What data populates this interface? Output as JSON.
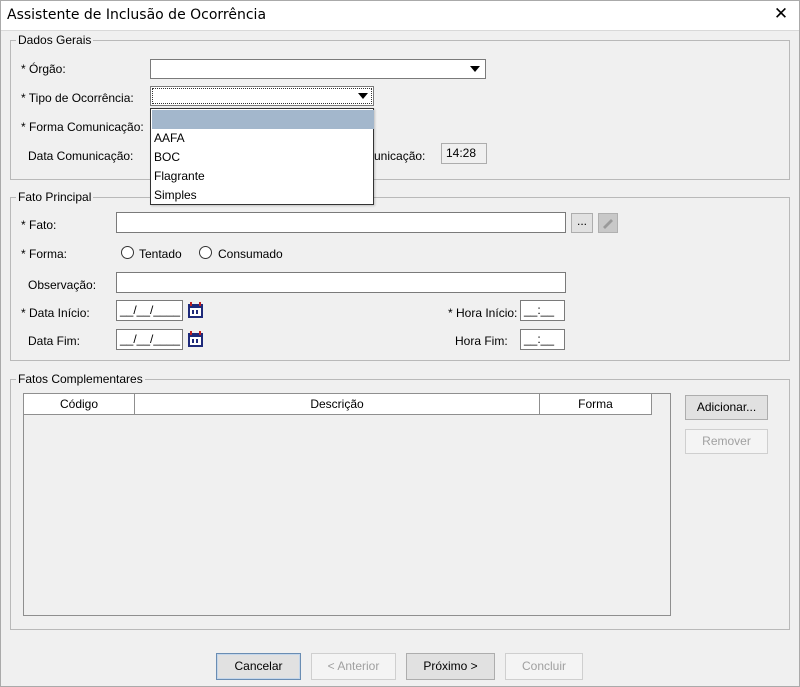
{
  "window": {
    "title": "Assistente de Inclusão de Ocorrência",
    "close_glyph": "✕"
  },
  "dados_gerais": {
    "legend": "Dados Gerais",
    "orgao_label": "* Órgão:",
    "orgao_value": "",
    "tipo_label": "* Tipo de Ocorrência:",
    "tipo_value": "",
    "forma_comunicacao_label": "* Forma Comunicação:",
    "data_comunicacao_label": "Data Comunicação:",
    "hora_comunicacao_partial_label": "unicação:",
    "hora_comunicacao_value": "14:28"
  },
  "tipo_dropdown": {
    "options": [
      "",
      "AAFA",
      "BOC",
      "Flagrante",
      "Simples"
    ],
    "selected_index": 0
  },
  "fato_principal": {
    "legend": "Fato Principal",
    "fato_label": "* Fato:",
    "fato_value": "",
    "browse_button": "...",
    "forma_label": "* Forma:",
    "tentado_label": "Tentado",
    "consumado_label": "Consumado",
    "observacao_label": "Observação:",
    "observacao_value": "",
    "data_inicio_label": "* Data Início:",
    "data_inicio_value": "__/__/____",
    "hora_inicio_label": "* Hora Início:",
    "hora_inicio_value": "__:__",
    "data_fim_label": "Data Fim:",
    "data_fim_value": "__/__/____",
    "hora_fim_label": "Hora Fim:",
    "hora_fim_value": "__:__"
  },
  "fatos_complementares": {
    "legend": "Fatos Complementares",
    "columns": [
      "Código",
      "Descrição",
      "Forma"
    ],
    "adicionar": "Adicionar...",
    "remover": "Remover"
  },
  "footer": {
    "cancelar": "Cancelar",
    "anterior": "< Anterior",
    "proximo": "Próximo >",
    "concluir": "Concluir"
  },
  "colors": {
    "dropdown_selection": "#a3b7cc",
    "calendar_icon": "#1e2a7a"
  }
}
